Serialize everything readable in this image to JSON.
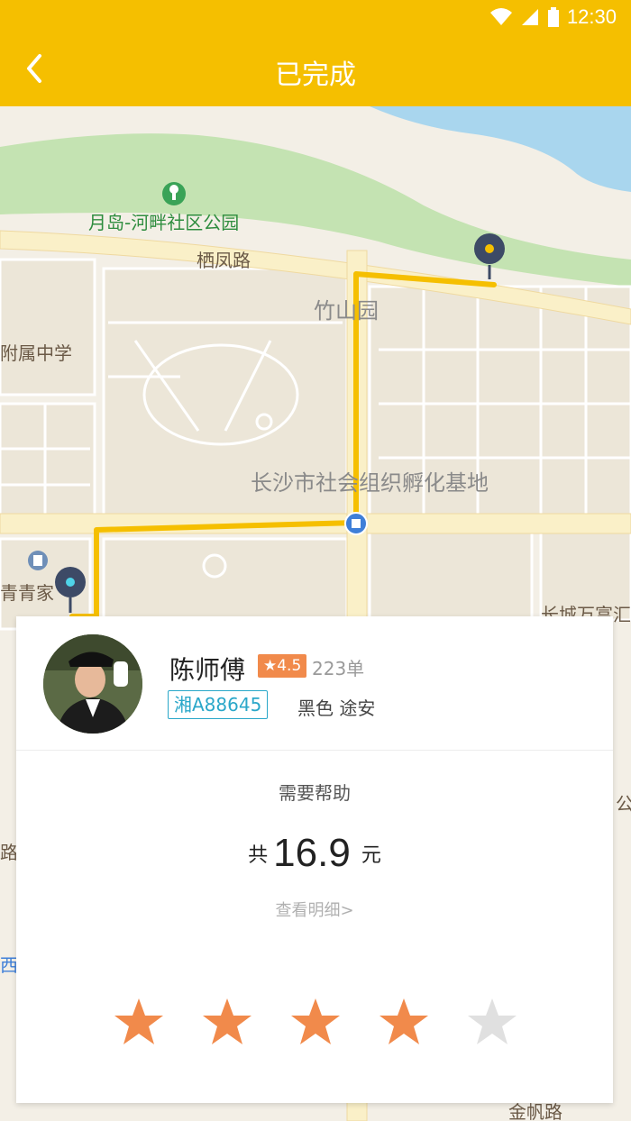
{
  "status_bar": {
    "time": "12:30",
    "icons": [
      "wifi-icon",
      "signal-icon",
      "battery-icon"
    ]
  },
  "header": {
    "title": "已完成",
    "back_icon": "chevron-left-icon"
  },
  "map": {
    "labels": {
      "park": "月岛-河畔社区公园",
      "road1": "栖凤路",
      "area1": "竹山园",
      "school": "附属中学",
      "base": "长沙市社会组织孵化基地",
      "qing": "青青家",
      "changcheng": "长城万富汇",
      "gong": "公",
      "lu": "路",
      "xi": "西",
      "jinfan": "金帆路"
    }
  },
  "driver": {
    "name": "陈师傅",
    "rating": "★4.5",
    "orders": "223单",
    "plate": "湘A88645",
    "car": "黑色  途安"
  },
  "trip": {
    "help": "需要帮助",
    "fare_prefix": "共",
    "fare_amount": "16.9",
    "fare_unit": "元",
    "detail": "查看明细>"
  },
  "rating": {
    "stars_filled": 4,
    "stars_total": 5
  },
  "colors": {
    "brand": "#f5bf00",
    "star_on": "#f18a4b",
    "star_off": "#e0e0e0",
    "plate": "#2aa7c9"
  }
}
